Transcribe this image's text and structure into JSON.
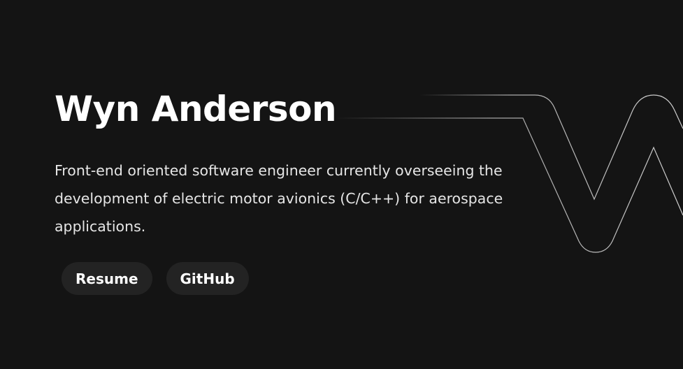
{
  "hero": {
    "name": "Wyn Anderson",
    "bio": "Front-end oriented software engineer currently overseeing the development of electric motor avionics (C/C++) for aerospace applications."
  },
  "actions": {
    "resume_label": "Resume",
    "github_label": "GitHub"
  },
  "colors": {
    "background": "#141414",
    "button_bg": "#232323",
    "text": "#ffffff",
    "decor_line": "#bdbdbd"
  }
}
